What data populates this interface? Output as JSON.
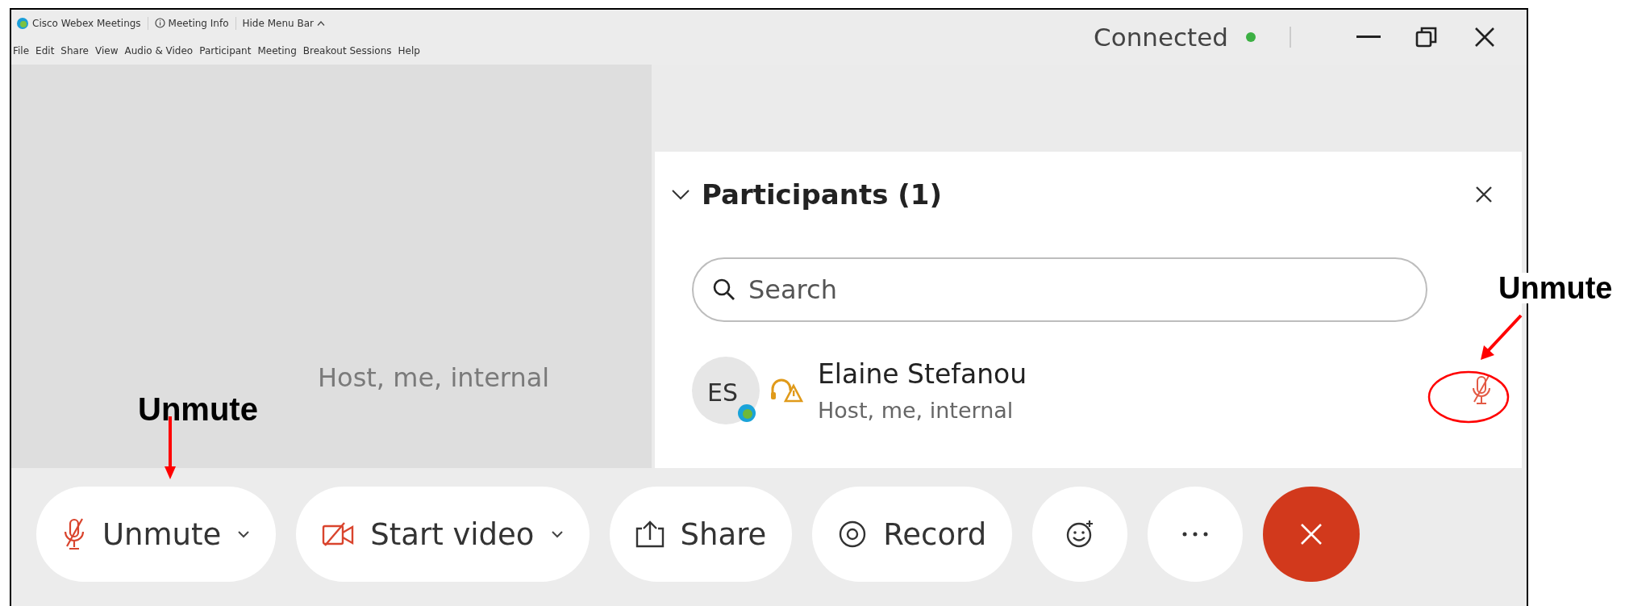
{
  "title_bar": {
    "app_name": "Cisco Webex Meetings",
    "meeting_info": "Meeting Info",
    "hide_menu_bar": "Hide Menu Bar"
  },
  "menu_bar": [
    "File",
    "Edit",
    "Share",
    "View",
    "Audio & Video",
    "Participant",
    "Meeting",
    "Breakout Sessions",
    "Help"
  ],
  "status": {
    "text": "Connected",
    "color": "#3cb043"
  },
  "video_area": {
    "ghost_text": "Host, me, internal"
  },
  "participants_panel": {
    "title": "Participants (1)",
    "expanded": true,
    "search": {
      "placeholder": "Search"
    },
    "participants": [
      {
        "initials": "ES",
        "name": "Elaine Stefanou",
        "role": "Host, me, internal",
        "muted": true
      }
    ]
  },
  "toolbar": [
    {
      "kind": "mute",
      "label": "Unmute",
      "dropdown": true
    },
    {
      "kind": "video",
      "label": "Start video",
      "dropdown": true
    },
    {
      "kind": "share",
      "label": "Share",
      "dropdown": false
    },
    {
      "kind": "record",
      "label": "Record",
      "dropdown": false
    },
    {
      "kind": "reactions",
      "dropdown": false
    },
    {
      "kind": "more",
      "dropdown": false
    },
    {
      "kind": "leave",
      "dropdown": false
    }
  ],
  "annotations": [
    {
      "text": "Unmute"
    },
    {
      "text": "Unmute"
    }
  ]
}
